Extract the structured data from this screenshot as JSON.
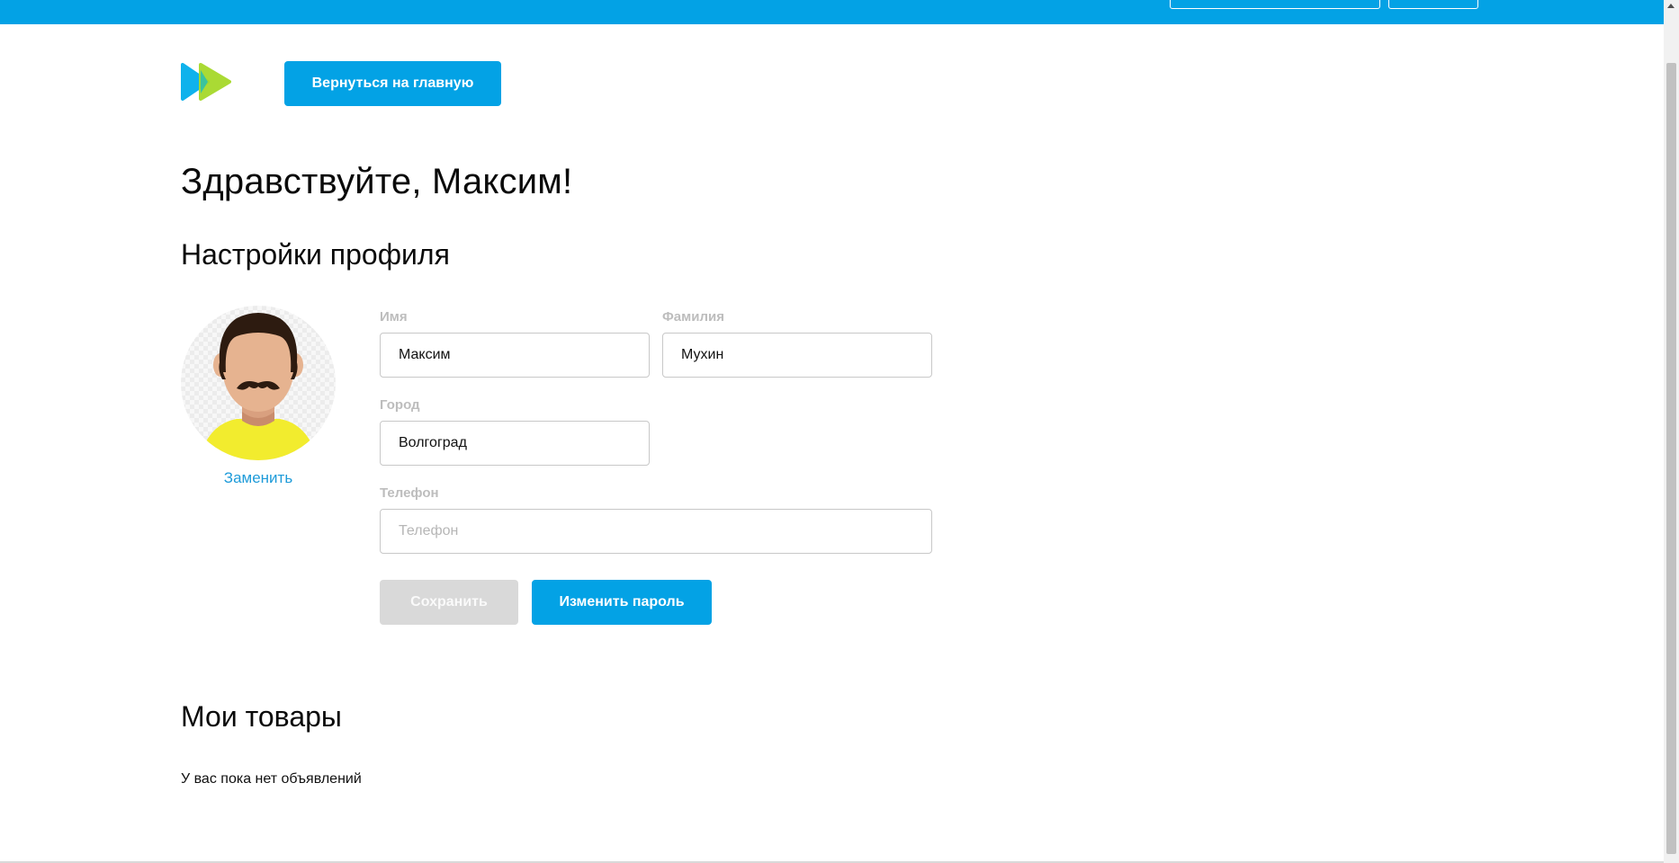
{
  "header": {
    "back_button": "Вернуться на главную"
  },
  "page": {
    "greeting": "Здравствуйте, Максим!",
    "settings_title": "Настройки профиля",
    "goods_title": "Мои товары",
    "no_goods_text": "У вас пока нет объявлений"
  },
  "avatar": {
    "replace_link": "Заменить"
  },
  "form": {
    "first_name": {
      "label": "Имя",
      "value": "Максим"
    },
    "last_name": {
      "label": "Фамилия",
      "value": "Мухин"
    },
    "city": {
      "label": "Город",
      "value": "Волгоград"
    },
    "phone": {
      "label": "Телефон",
      "value": "",
      "placeholder": "Телефон"
    },
    "save_button": "Сохранить",
    "change_password_button": "Изменить пароль"
  },
  "colors": {
    "accent": "#03a2e5",
    "disabled": "#d9d9d9",
    "link": "#1e9bd9",
    "logo_blue": "#0fb2ec",
    "logo_green": "#a6d92a"
  }
}
